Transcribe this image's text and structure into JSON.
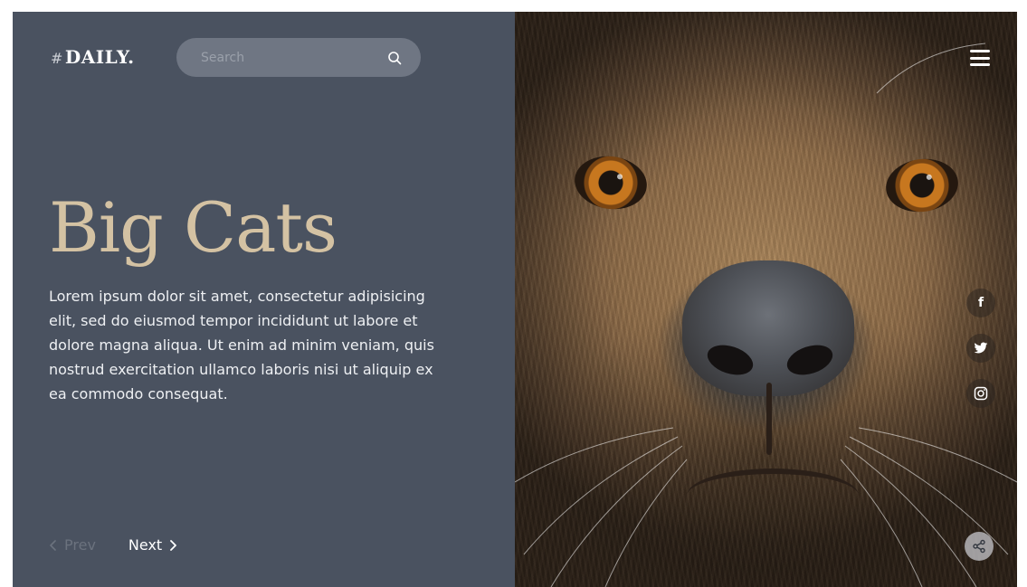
{
  "brand": {
    "hash": "#",
    "name": "DAILY."
  },
  "search": {
    "placeholder": "Search",
    "value": "",
    "icon": "search-icon"
  },
  "hero": {
    "title": "Big Cats",
    "description": "Lorem ipsum dolor sit amet, consectetur adipisicing elit, sed do eiusmod tempor incididunt ut labore et dolore magna aliqua. Ut enim ad minim veniam, quis nostrud exercitation ullamco laboris nisi ut aliquip ex ea commodo consequat."
  },
  "pager": {
    "prev_label": "Prev",
    "next_label": "Next"
  },
  "social": {
    "facebook": "f"
  },
  "colors": {
    "panel_bg": "#4a5260",
    "title_accent": "#d4c2a3",
    "search_bg": "#6f7683",
    "prev_muted": "#6b727e"
  },
  "icons": {
    "menu": "hamburger-menu-icon",
    "facebook": "facebook-icon",
    "twitter": "twitter-icon",
    "instagram": "instagram-icon",
    "share": "share-icon",
    "prev": "chevron-left-icon",
    "next": "chevron-right-icon"
  }
}
